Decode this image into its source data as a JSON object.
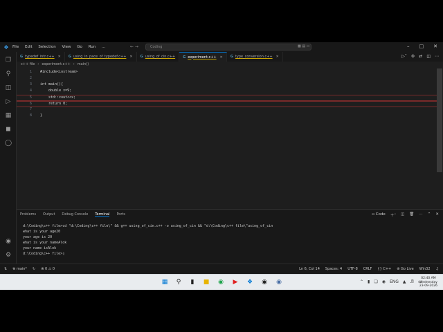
{
  "title": {
    "menu": [
      "File",
      "Edit",
      "Selection",
      "View",
      "Go",
      "Run",
      "…"
    ],
    "search": "Coding"
  },
  "tabs": [
    {
      "name": "typedef_intr.c++",
      "active": false
    },
    {
      "name": "using_in_pace_of_typedef.c++",
      "active": false
    },
    {
      "name": "using_of_cin.c++",
      "active": false
    },
    {
      "name": "experiment.c++",
      "active": true
    },
    {
      "name": "type_conversion.c++",
      "active": false
    }
  ],
  "breadcrumb": [
    "c++ file",
    "experiment.c++",
    "main()"
  ],
  "code": [
    {
      "n": "1",
      "t": "#include<iostream>"
    },
    {
      "n": "2",
      "t": ""
    },
    {
      "n": "3",
      "t": "int main(){"
    },
    {
      "n": "4",
      "t": "    double x=9;"
    },
    {
      "n": "5",
      "t": "    std::cout<<x;"
    },
    {
      "n": "6",
      "t": "    return 0;"
    },
    {
      "n": "7",
      "t": ""
    },
    {
      "n": "8",
      "t": "}"
    }
  ],
  "panel": {
    "tabs": [
      "Problems",
      "Output",
      "Debug Console",
      "Terminal",
      "Ports"
    ],
    "active": "Terminal",
    "shell": "Code"
  },
  "terminal": [
    "d:\\Coding\\c++ file>cd \"d:\\Coding\\c++ file\\\" && g++ using_of_cin.c++ -o using_of_cin && \"d:\\Coding\\c++ file\\\"using_of_cin",
    "what is your age20",
    "your age is 20",
    "what is your nameAlok",
    "your name isAlok",
    "d:\\Coding\\c++ file>"
  ],
  "status": {
    "branch": "main*",
    "errors": "0",
    "warnings": "0",
    "pos": "Ln 6, Col 14",
    "spaces": "Spaces: 4",
    "enc": "UTF-8",
    "eol": "CRLF",
    "lang": "{} C++",
    "live": "Go Live",
    "platform": "Win32"
  },
  "clock": {
    "time": "02:40 AM",
    "day": "Wednesday",
    "date": "23-09-2026"
  },
  "tray": {
    "lang": "ENG"
  }
}
